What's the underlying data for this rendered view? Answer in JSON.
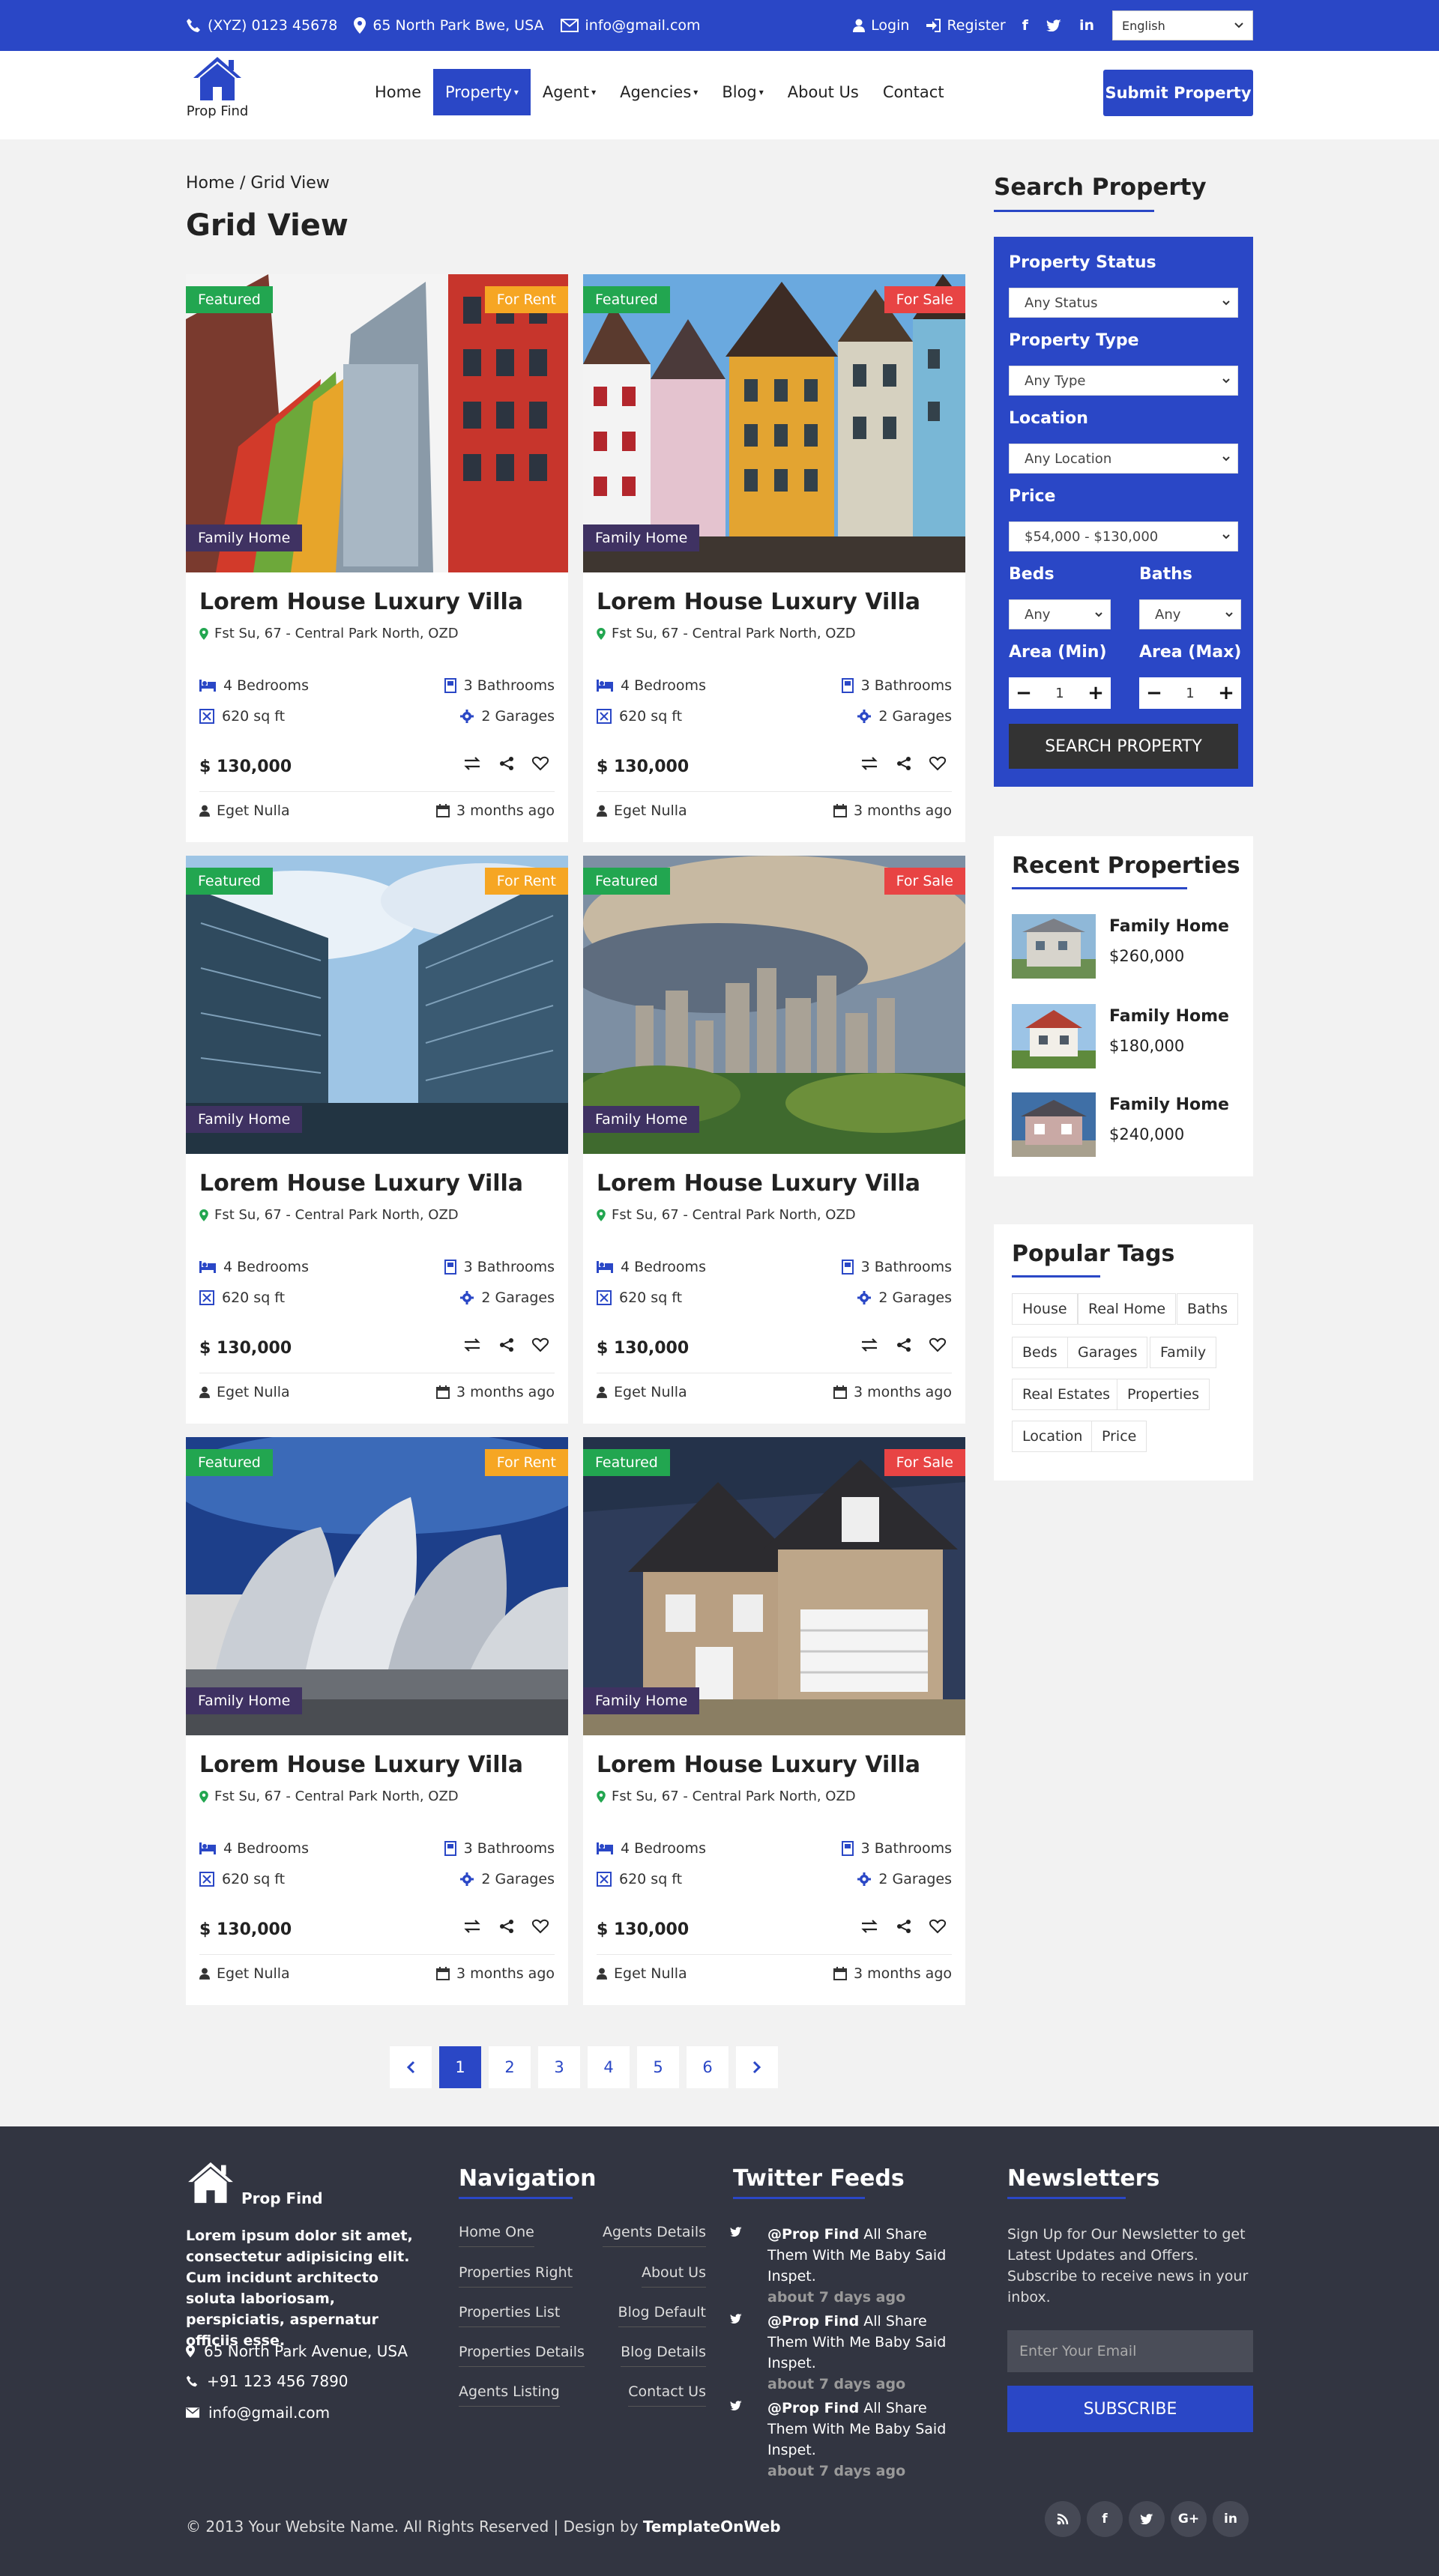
{
  "colors": {
    "brand": "#2a47c6",
    "featured": "#22a650",
    "for_rent": "#f6a623",
    "for_sale": "#e84444",
    "family": "#3f3262",
    "footer": "#323541"
  },
  "topbar": {
    "phone": "(XYZ) 0123 45678",
    "address": "65 North Park Bwe, USA",
    "email": "info@gmail.com",
    "login": "Login",
    "register": "Register",
    "social": [
      "f",
      "t",
      "in"
    ],
    "language": "English"
  },
  "header": {
    "logo_text": "Prop Find",
    "nav": [
      "Home",
      "Property",
      "Agent",
      "Agencies",
      "Blog",
      "About Us",
      "Contact"
    ],
    "active_nav": "Property",
    "submit": "Submit Property"
  },
  "breadcrumb": {
    "home": "Home",
    "sep": "/",
    "current": "Grid View"
  },
  "page_title": "Grid View",
  "listings": [
    {
      "featured": "Featured",
      "status": "For Rent",
      "type": "Family Home",
      "title": "Lorem House Luxury Villa",
      "address": "Fst Su, 67 - Central Park North, OZD",
      "bedrooms": "4 Bedrooms",
      "bathrooms": "3 Bathrooms",
      "area": "620 sq ft",
      "garages": "2 Garages",
      "price": "$ 130,000",
      "owner": "Eget Nulla",
      "time": "3 months ago"
    },
    {
      "featured": "Featured",
      "status": "For Sale",
      "type": "Family Home",
      "title": "Lorem House Luxury Villa",
      "address": "Fst Su, 67 - Central Park North, OZD",
      "bedrooms": "4 Bedrooms",
      "bathrooms": "3 Bathrooms",
      "area": "620 sq ft",
      "garages": "2 Garages",
      "price": "$ 130,000",
      "owner": "Eget Nulla",
      "time": "3 months ago"
    },
    {
      "featured": "Featured",
      "status": "For Rent",
      "type": "Family Home",
      "title": "Lorem House Luxury Villa",
      "address": "Fst Su, 67 - Central Park North, OZD",
      "bedrooms": "4 Bedrooms",
      "bathrooms": "3 Bathrooms",
      "area": "620 sq ft",
      "garages": "2 Garages",
      "price": "$ 130,000",
      "owner": "Eget Nulla",
      "time": "3 months ago"
    },
    {
      "featured": "Featured",
      "status": "For Sale",
      "type": "Family Home",
      "title": "Lorem House Luxury Villa",
      "address": "Fst Su, 67 - Central Park North, OZD",
      "bedrooms": "4 Bedrooms",
      "bathrooms": "3 Bathrooms",
      "area": "620 sq ft",
      "garages": "2 Garages",
      "price": "$ 130,000",
      "owner": "Eget Nulla",
      "time": "3 months ago"
    },
    {
      "featured": "Featured",
      "status": "For Rent",
      "type": "Family Home",
      "title": "Lorem House Luxury Villa",
      "address": "Fst Su, 67 - Central Park North, OZD",
      "bedrooms": "4 Bedrooms",
      "bathrooms": "3 Bathrooms",
      "area": "620 sq ft",
      "garages": "2 Garages",
      "price": "$ 130,000",
      "owner": "Eget Nulla",
      "time": "3 months ago"
    },
    {
      "featured": "Featured",
      "status": "For Sale",
      "type": "Family Home",
      "title": "Lorem House Luxury Villa",
      "address": "Fst Su, 67 - Central Park North, OZD",
      "bedrooms": "4 Bedrooms",
      "bathrooms": "3 Bathrooms",
      "area": "620 sq ft",
      "garages": "2 Garages",
      "price": "$ 130,000",
      "owner": "Eget Nulla",
      "time": "3 months ago"
    }
  ],
  "pagination": {
    "pages": [
      "1",
      "2",
      "3",
      "4",
      "5",
      "6"
    ],
    "active": "1"
  },
  "search": {
    "title": "Search Property",
    "status_label": "Property Status",
    "status_value": "Any Status",
    "type_label": "Property Type",
    "type_value": "Any Type",
    "location_label": "Location",
    "location_value": "Any Location",
    "price_label": "Price",
    "price_value": "$54,000 - $130,000",
    "beds_label": "Beds",
    "beds_value": "Any",
    "baths_label": "Baths",
    "baths_value": "Any",
    "area_min_label": "Area (Min)",
    "area_min_value": "1",
    "area_max_label": "Area (Max)",
    "area_max_value": "1",
    "button": "SEARCH PROPERTY"
  },
  "recent": {
    "title": "Recent Properties",
    "items": [
      {
        "name": "Family Home",
        "price": "$260,000"
      },
      {
        "name": "Family Home",
        "price": "$180,000"
      },
      {
        "name": "Family Home",
        "price": "$240,000"
      }
    ]
  },
  "tags": {
    "title": "Popular Tags",
    "items": [
      "House",
      "Real Home",
      "Baths",
      "Beds",
      "Garages",
      "Family",
      "Real Estates",
      "Properties",
      "Location",
      "Price"
    ]
  },
  "footer": {
    "logo_text": "Prop Find",
    "about": "Lorem ipsum dolor sit amet, consectetur adipisicing elit. Cum incidunt architecto soluta laboriosam, perspiciatis, aspernatur officiis esse.",
    "address": "65 North Park Avenue, USA",
    "phone": "+91 123 456 7890",
    "email": "info@gmail.com",
    "nav_title": "Navigation",
    "nav_left": [
      "Home One",
      "Properties Right",
      "Properties List",
      "Properties Details",
      "Agents Listing"
    ],
    "nav_right": [
      "Agents Details",
      "About Us",
      "Blog Default",
      "Blog Details",
      "Contact Us"
    ],
    "twitter_title": "Twitter Feeds",
    "tweets": [
      {
        "handle": "@Prop Find",
        "text": "All Share Them With Me Baby Said Inspet.",
        "time": "about 7 days ago"
      },
      {
        "handle": "@Prop Find",
        "text": "All Share Them With Me Baby Said Inspet.",
        "time": "about 7 days ago"
      },
      {
        "handle": "@Prop Find",
        "text": "All Share Them With Me Baby Said Inspet.",
        "time": "about 7 days ago"
      }
    ],
    "news_title": "Newsletters",
    "news_text": "Sign Up for Our Newsletter to get Latest Updates and Offers. Subscribe to receive news in your inbox.",
    "news_placeholder": "Enter Your Email",
    "news_button": "SUBSCRIBE",
    "copyright": "© 2013 Your Website Name. All Rights Reserved | Design by",
    "designer": "TemplateOnWeb",
    "social": [
      "rss",
      "f",
      "t",
      "G+",
      "in"
    ]
  }
}
